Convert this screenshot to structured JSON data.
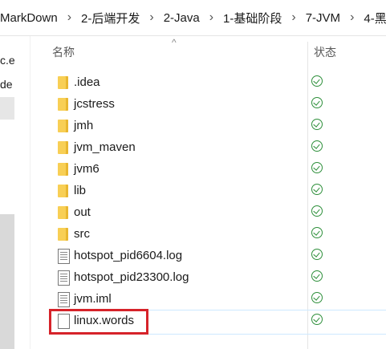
{
  "breadcrumb": [
    "MarkDown",
    "2-后端开发",
    "2-Java",
    "1-基础阶段",
    "7-JVM",
    "4-黑"
  ],
  "nav": {
    "items": [
      "c.e",
      "de"
    ]
  },
  "columns": {
    "name": "名称",
    "status": "状态"
  },
  "files": [
    {
      "name": ".idea",
      "type": "folder",
      "status": "synced"
    },
    {
      "name": "jcstress",
      "type": "folder",
      "status": "synced"
    },
    {
      "name": "jmh",
      "type": "folder",
      "status": "synced"
    },
    {
      "name": "jvm_maven",
      "type": "folder",
      "status": "synced"
    },
    {
      "name": "jvm6",
      "type": "folder",
      "status": "synced"
    },
    {
      "name": "lib",
      "type": "folder",
      "status": "synced"
    },
    {
      "name": "out",
      "type": "folder",
      "status": "synced"
    },
    {
      "name": "src",
      "type": "folder",
      "status": "synced"
    },
    {
      "name": "hotspot_pid6604.log",
      "type": "file",
      "status": "synced"
    },
    {
      "name": "hotspot_pid23300.log",
      "type": "file",
      "status": "synced"
    },
    {
      "name": "jvm.iml",
      "type": "file",
      "status": "synced"
    },
    {
      "name": "linux.words",
      "type": "file",
      "status": "synced"
    }
  ],
  "highlight_color": "#d6232a",
  "status_color": "#2d8f3a",
  "folder_color": "#f8cf55"
}
